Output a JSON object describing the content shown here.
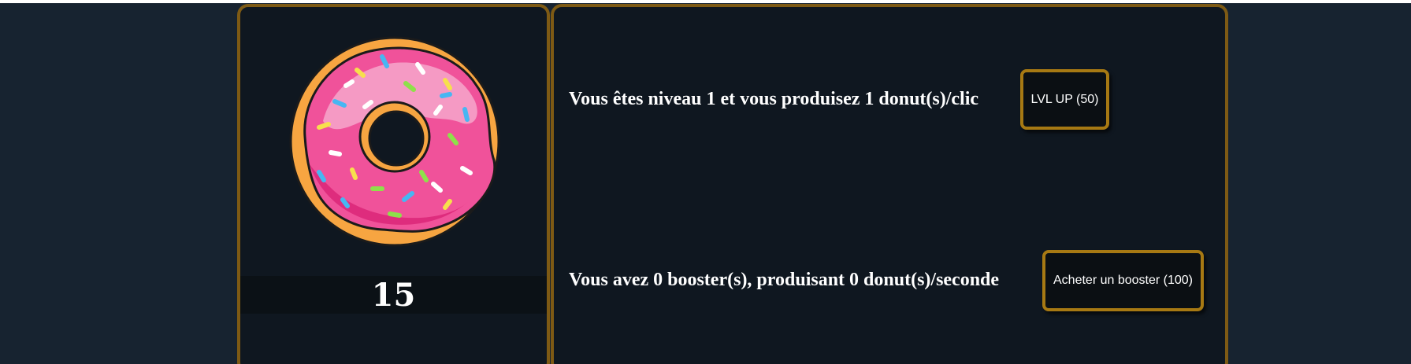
{
  "game": {
    "score": "15",
    "level_status": "Vous êtes niveau 1 et vous produisez 1 donut(s)/clic",
    "booster_status": "Vous avez 0 booster(s), produisant 0 donut(s)/seconde"
  },
  "buttons": {
    "lvl_up_label": "LVL UP (50)",
    "buy_booster_label": "Acheter un booster (100)"
  },
  "colors": {
    "page_background": "#172330",
    "panel_background": "#0f1720",
    "panel_border": "#7e5a14",
    "button_border": "#a77913",
    "donut_icing": "#f0529a",
    "donut_dough": "#f7a541"
  },
  "icons": {
    "donut": "donut-icon"
  }
}
